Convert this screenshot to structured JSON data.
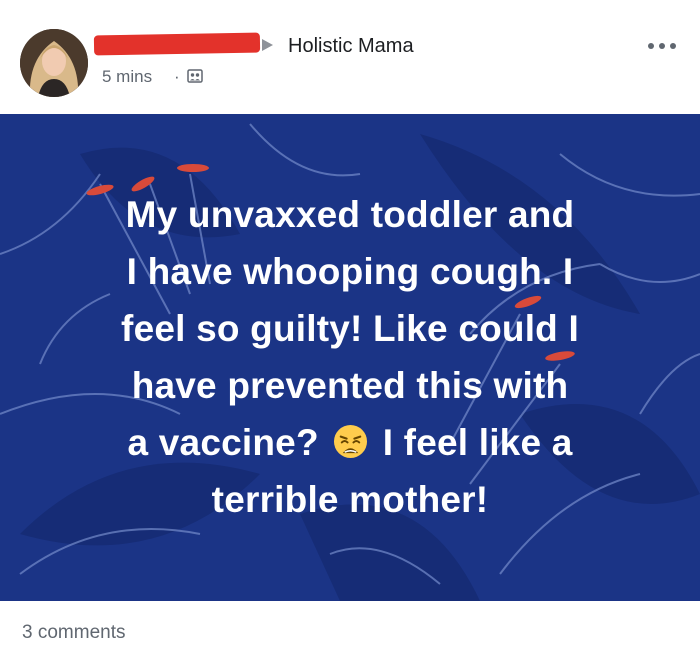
{
  "post": {
    "author_name": "",
    "group_name": "Holistic Mama",
    "timestamp": "5 mins",
    "separator": "·",
    "audience_icon": "group-icon",
    "more_icon": "more-options-icon",
    "colors": {
      "banner_background": "#1b3486",
      "redaction": "#e3322b",
      "text": "#ffffff"
    },
    "text_lines": [
      "My unvaxxed toddler and",
      "I have whooping cough. I",
      "feel so guilty! Like could I",
      "have prevented this with"
    ],
    "line5_before": "a vaccine? ",
    "emoji": "weary-face-emoji",
    "line5_after": " I feel like a",
    "line6": "terrible mother!",
    "comments_count": "3 comments"
  }
}
